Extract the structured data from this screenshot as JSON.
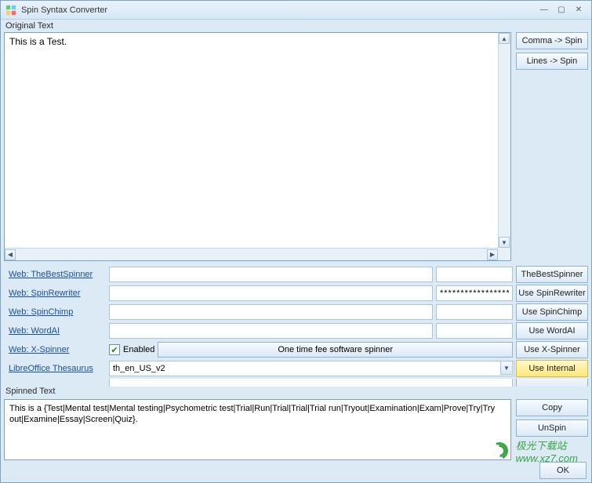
{
  "title": "Spin Syntax Converter",
  "sections": {
    "original_label": "Original Text",
    "spinned_label": "Spinned Text"
  },
  "original_text": "This is a Test.",
  "top_buttons": {
    "comma": "Comma -> Spin",
    "lines": "Lines -> Spin"
  },
  "spinners": [
    {
      "link": "Web: TheBestSpinner",
      "input1": "",
      "input2": "",
      "button": "TheBestSpinner"
    },
    {
      "link": "Web: SpinRewriter",
      "input1": "",
      "input2": "******************",
      "button": "Use SpinRewriter"
    },
    {
      "link": "Web: SpinChimp",
      "input1": "",
      "input2": "",
      "button": "Use SpinChimp"
    },
    {
      "link": "Web: WordAI",
      "input1": "",
      "input2": "",
      "button": "Use WordAI"
    }
  ],
  "xspinner": {
    "link": "Web: X-Spinner",
    "enabled_checked": true,
    "enabled_label": "Enabled",
    "onetime": "One time fee software spinner",
    "button": "Use X-Spinner"
  },
  "libre": {
    "link": "LibreOffice Thesaurus",
    "select_value": "th_en_US_v2",
    "button": "Use Internal"
  },
  "extra_row": {
    "link": "",
    "button": ""
  },
  "spinned_text": "This is a {Test|Mental test|Mental testing|Psychometric test|Trial|Run|Trial|Trial|Trial run|Tryout|Examination|Exam|Prove|Try|Try out|Examine|Essay|Screen|Quiz}.",
  "spinned_buttons": {
    "copy": "Copy",
    "unspin": "UnSpin"
  },
  "ok": "OK",
  "watermark": {
    "text1": "极光下载站",
    "text2": "www.xz7.com"
  }
}
